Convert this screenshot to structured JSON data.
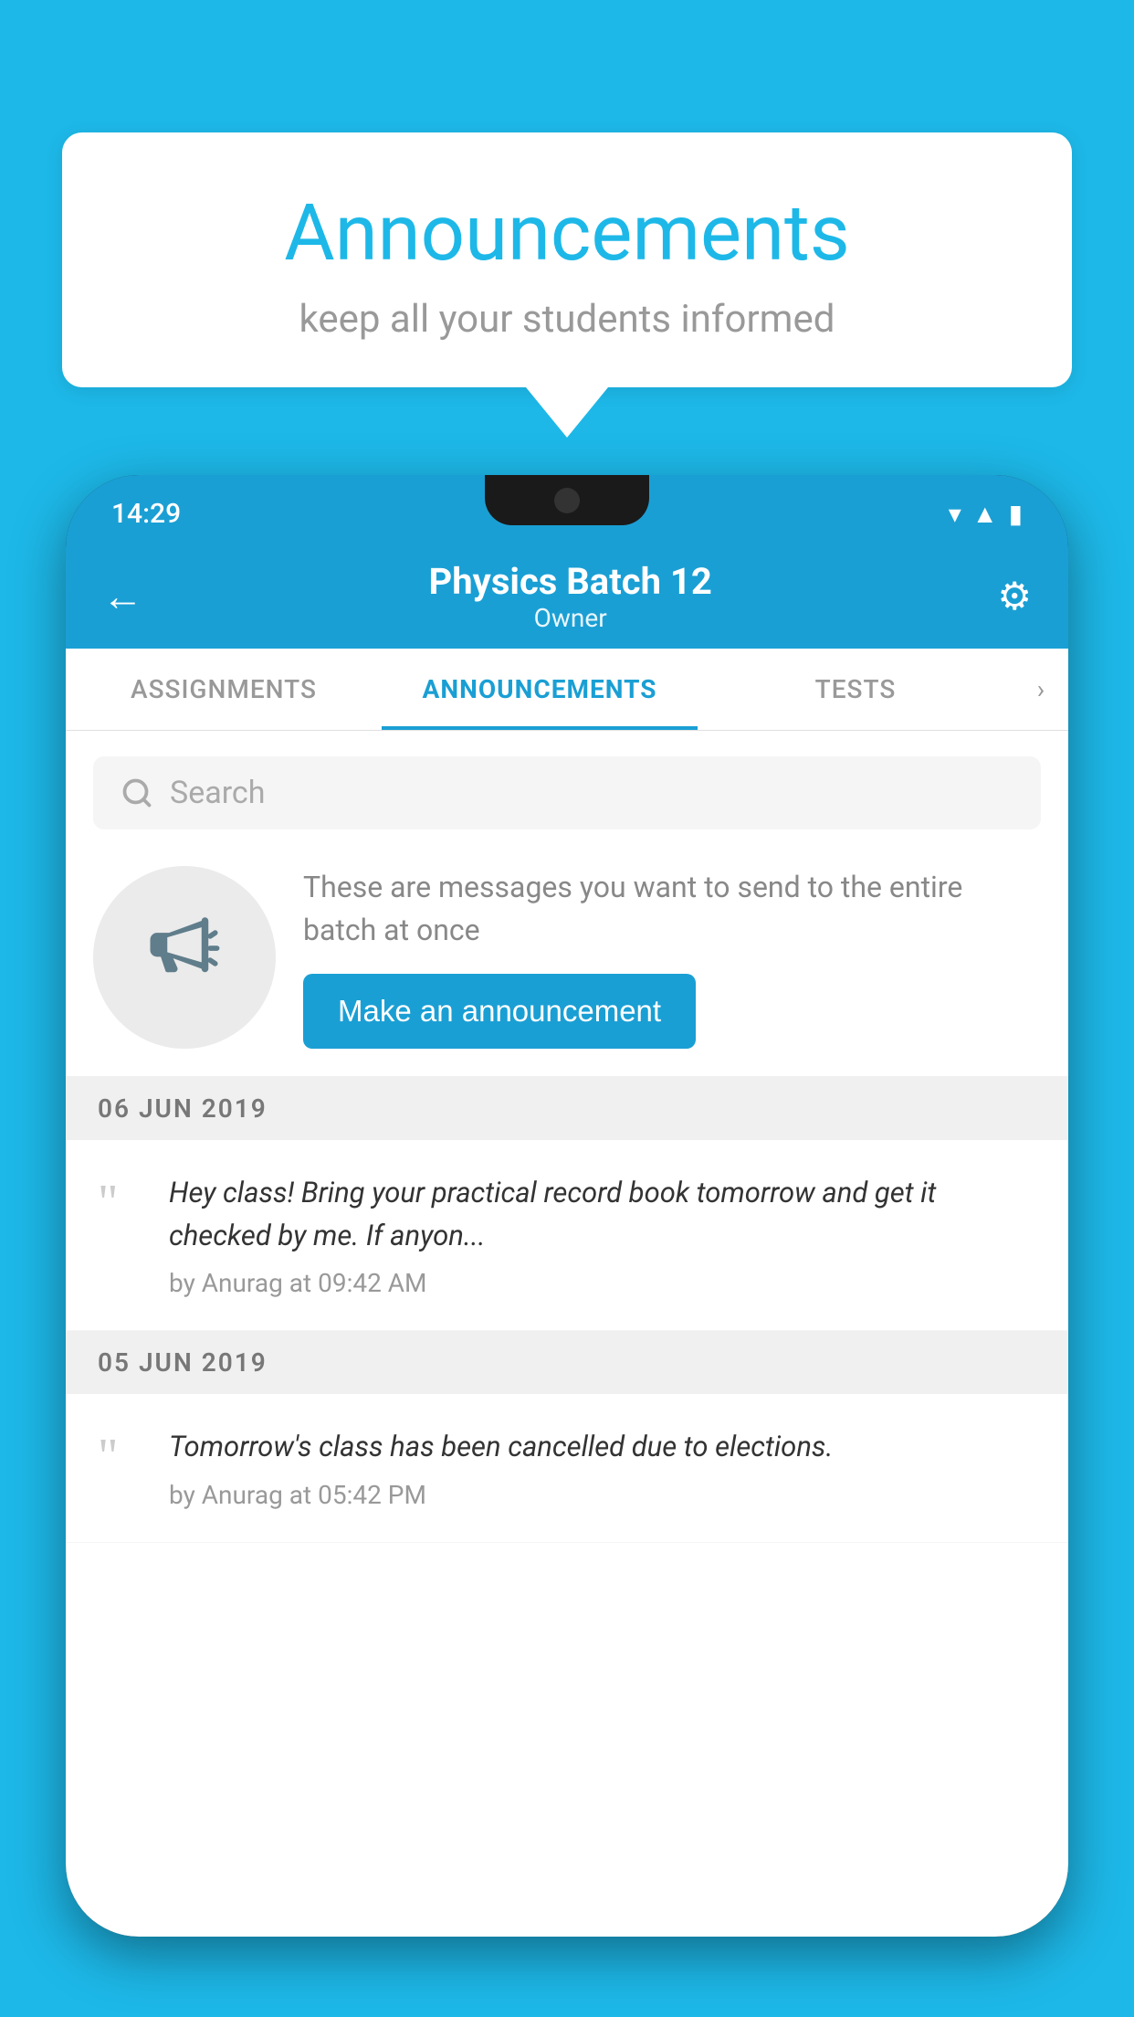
{
  "speech_bubble": {
    "title": "Announcements",
    "subtitle": "keep all your students informed"
  },
  "status_bar": {
    "time": "14:29",
    "icons": [
      "wifi",
      "signal",
      "battery"
    ]
  },
  "app_bar": {
    "title": "Physics Batch 12",
    "subtitle": "Owner",
    "back_label": "←",
    "settings_label": "⚙"
  },
  "tabs": [
    {
      "label": "ASSIGNMENTS",
      "active": false
    },
    {
      "label": "ANNOUNCEMENTS",
      "active": true
    },
    {
      "label": "TESTS",
      "active": false
    }
  ],
  "tab_more": "›",
  "search": {
    "placeholder": "Search"
  },
  "promo": {
    "description": "These are messages you want to send to the entire batch at once",
    "button_label": "Make an announcement"
  },
  "announcements": [
    {
      "date": "06  JUN  2019",
      "text": "Hey class! Bring your practical record book tomorrow and get it checked by me. If anyon...",
      "author": "by Anurag at 09:42 AM"
    },
    {
      "date": "05  JUN  2019",
      "text": "Tomorrow's class has been cancelled due to elections.",
      "author": "by Anurag at 05:42 PM"
    }
  ]
}
